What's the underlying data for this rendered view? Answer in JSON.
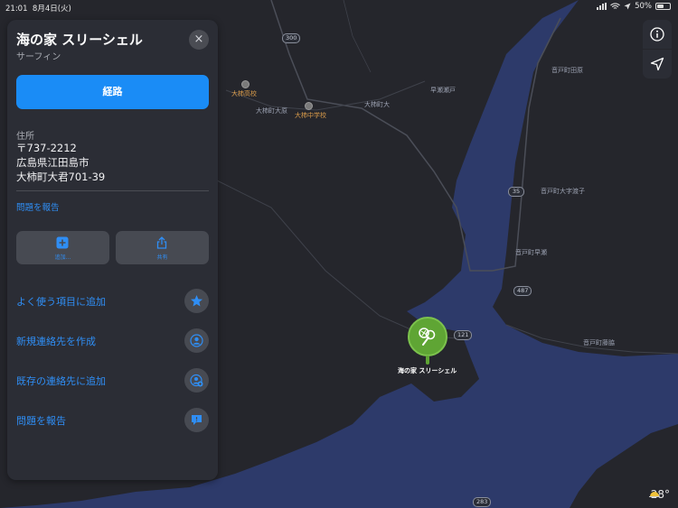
{
  "status_bar": {
    "time": "21:01",
    "date": "8月4日(火)",
    "battery": "50%"
  },
  "map": {
    "labels": {
      "ohgaki_high": "大柿高校",
      "ohgaki_ohhara": "大柿町大原",
      "ohgaki_middle": "大柿中学校",
      "ohgaki_oh": "大柿町大",
      "hayase_strait": "早瀬瀬戸",
      "ondo_tahara": "音戸町田原",
      "ondo_otani": "音戸町大字渡子",
      "ondo_hayase": "音戸町早瀬",
      "ondo_hata": "音戸町藤脇"
    },
    "routes": [
      "300",
      "35",
      "487",
      "121",
      "283"
    ],
    "pin_label": "海の家 スリーシェル",
    "temperature": "28°"
  },
  "panel": {
    "title": "海の家 スリーシェル",
    "subtitle": "サーフィン",
    "close_icon": "×",
    "route_button": "経路",
    "address_heading": "住所",
    "address_lines": [
      "〒737-2212",
      "広島県江田島市",
      "大柿町大君701-39"
    ],
    "report_link": "問題を報告",
    "actions": [
      {
        "label": "追加...",
        "icon": "plus-square-icon"
      },
      {
        "label": "共有",
        "icon": "share-icon"
      }
    ],
    "rows": [
      {
        "label": "よく使う項目に追加",
        "icon": "star-icon"
      },
      {
        "label": "新規連絡先を作成",
        "icon": "contact-icon"
      },
      {
        "label": "既存の連絡先に追加",
        "icon": "contact-add-icon"
      },
      {
        "label": "問題を報告",
        "icon": "report-icon"
      }
    ]
  },
  "colors": {
    "accent": "#1a8cf6",
    "link": "#2f8ef5",
    "water": "#2d3a6a",
    "land": "#25262c",
    "pin": "#5fa534"
  }
}
